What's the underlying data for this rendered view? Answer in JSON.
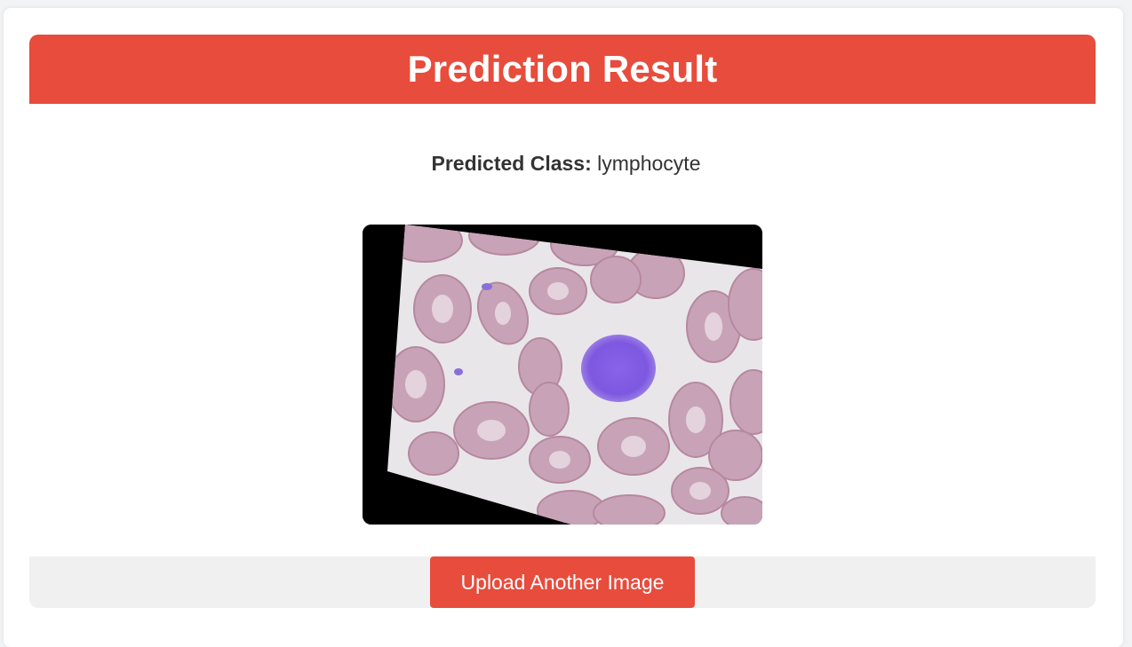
{
  "header": {
    "title": "Prediction Result"
  },
  "result": {
    "label": "Predicted Class:",
    "value": "lymphocyte"
  },
  "image": {
    "icon": "blood-smear-image"
  },
  "actions": {
    "upload_label": "Upload Another Image"
  },
  "colors": {
    "accent": "#e74c3c",
    "footer_bg": "#f0f0f0",
    "text": "#333333"
  }
}
